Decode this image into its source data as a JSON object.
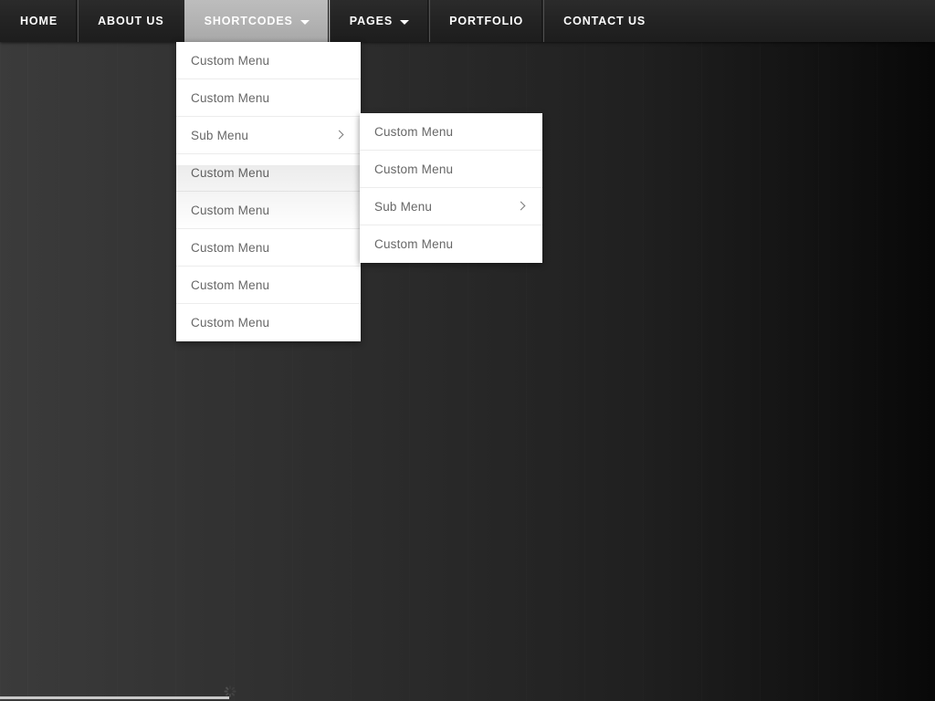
{
  "navbar": {
    "items": [
      {
        "label": "HOME",
        "has_caret": false,
        "active": false
      },
      {
        "label": "ABOUT US",
        "has_caret": false,
        "active": false
      },
      {
        "label": "SHORTCODES",
        "has_caret": true,
        "active": true
      },
      {
        "label": "PAGES",
        "has_caret": true,
        "active": false
      },
      {
        "label": "PORTFOLIO",
        "has_caret": false,
        "active": false
      },
      {
        "label": "CONTACT US",
        "has_caret": false,
        "active": false
      }
    ],
    "colors": {
      "bar_background": "#232323",
      "active_background": "#b2b2b2",
      "label_color": "#ffffff"
    }
  },
  "dropdown_main": {
    "parent": "SHORTCODES",
    "items": [
      {
        "label": "Custom Menu",
        "has_submenu": false
      },
      {
        "label": "Custom Menu",
        "has_submenu": false
      },
      {
        "label": "Sub Menu",
        "has_submenu": true
      },
      {
        "label": "Custom Menu",
        "has_submenu": false
      },
      {
        "label": "Custom Menu",
        "has_submenu": false
      },
      {
        "label": "Custom Menu",
        "has_submenu": false
      },
      {
        "label": "Custom Menu",
        "has_submenu": false
      },
      {
        "label": "Custom Menu",
        "has_submenu": false
      }
    ]
  },
  "dropdown_sub": {
    "parent": "Sub Menu",
    "items": [
      {
        "label": "Custom Menu",
        "has_submenu": false
      },
      {
        "label": "Custom Menu",
        "has_submenu": false
      },
      {
        "label": "Sub Menu",
        "has_submenu": true
      },
      {
        "label": "Custom Menu",
        "has_submenu": false
      }
    ]
  },
  "menu_colors": {
    "panel_background": "#ffffff",
    "item_text": "#676767",
    "divider": "#ececec",
    "arrow": "#7a7a7a"
  },
  "page": {
    "background_left": "#3b3b3b",
    "background_right": "#080808"
  },
  "loading": {
    "progress_color": "#c9c9c9",
    "spinner_name": "spinner-icon"
  }
}
